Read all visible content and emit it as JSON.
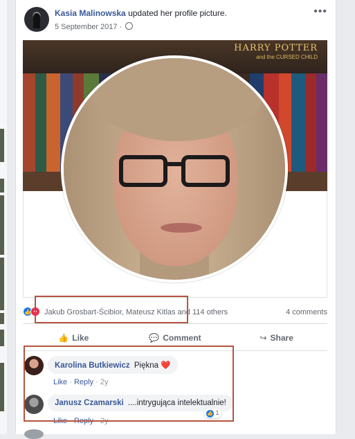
{
  "post": {
    "author": "Kasia Malinowska",
    "action": "updated her profile picture.",
    "date": "5 September 2017",
    "date_separator": "·",
    "more": "•••"
  },
  "cover": {
    "book_title": "HARRY POTTER",
    "book_subtitle": "and the CURSED CHILD"
  },
  "reactions": {
    "reactors": "Jakub Grosbart-Ścibior, Mateusz Kitlas and 114 others",
    "comments_count": "4 comments"
  },
  "actions": {
    "like": "Like",
    "comment": "Comment",
    "share": "Share"
  },
  "comments": [
    {
      "name": "Karolina Butkiewicz",
      "text": "Piękna",
      "like": "Like",
      "reply": "Reply",
      "time": "2y"
    },
    {
      "name": "Janusz Czamarski",
      "text": "....intrygująca intelektualnie!",
      "like": "Like",
      "reply": "Reply",
      "time": "2y",
      "reaction_count": "1"
    }
  ],
  "colors": {
    "link": "#385898",
    "highlight_box": "#b5543f"
  }
}
